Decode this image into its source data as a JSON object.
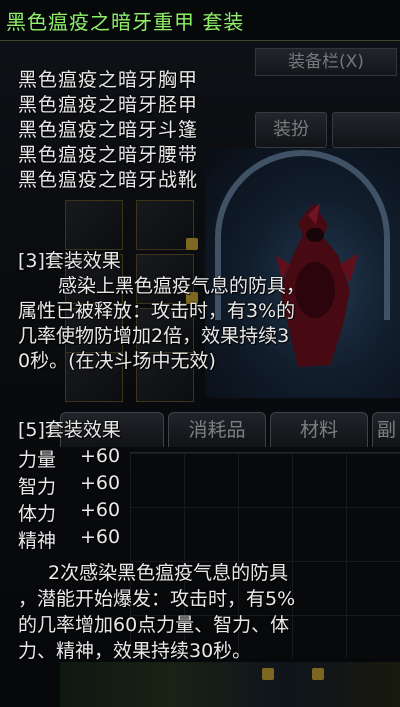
{
  "tooltip": {
    "title": "黑色瘟疫之暗牙重甲  套装",
    "pieces": [
      "黑色瘟疫之暗牙胸甲",
      "黑色瘟疫之暗牙胫甲",
      "黑色瘟疫之暗牙斗篷",
      "黑色瘟疫之暗牙腰带",
      "黑色瘟疫之暗牙战靴"
    ],
    "set3": {
      "header": "[3]套装效果",
      "lines": [
        "感染上黑色瘟疫气息的防具，",
        "属性已被释放：攻击时，有3%的",
        "几率使物防增加2倍，效果持续3",
        "0秒。(在决斗场中无效)"
      ]
    },
    "set5": {
      "header": "[5]套装效果",
      "stats": [
        {
          "name": "力量",
          "value": "+60"
        },
        {
          "name": "智力",
          "value": "+60"
        },
        {
          "name": "体力",
          "value": "+60"
        },
        {
          "name": "精神",
          "value": "+60"
        }
      ],
      "lines": [
        "2次感染黑色瘟疫气息的防具",
        "，潜能开始爆发：攻击时，有5%",
        "的几率增加60点力量、智力、体",
        "力、精神，效果持续30秒。"
      ]
    }
  },
  "window": {
    "equipment_header": "装备栏(X)",
    "dressup_button": "装扮",
    "tabs": [
      "消耗品",
      "材料",
      "副"
    ]
  },
  "colors": {
    "title": "#8ff06a",
    "text": "#e9e9e9"
  }
}
